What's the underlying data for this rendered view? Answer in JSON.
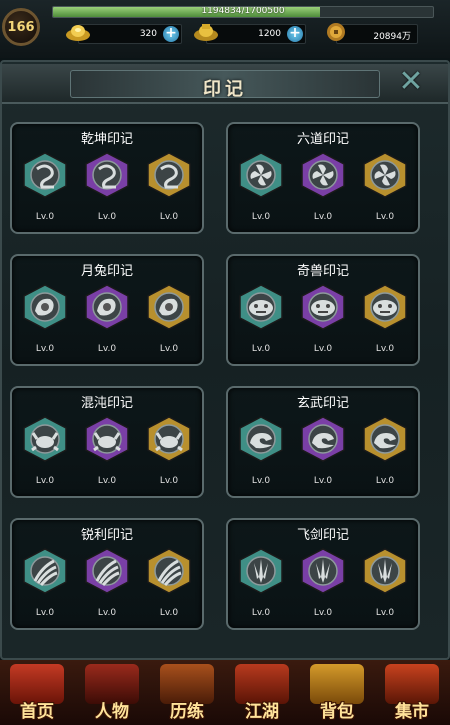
{
  "player": {
    "level": "166",
    "exp_text": "1194834/1700500",
    "exp_fraction": 0.702
  },
  "resources": [
    {
      "name": "gold-ingot",
      "value": "320"
    },
    {
      "name": "silver-ingot",
      "value": "1200"
    },
    {
      "name": "coin",
      "value": "20894万"
    }
  ],
  "panel": {
    "title": "印记"
  },
  "marks": [
    {
      "name": "乾坤印记",
      "emblem": "swirl-glyph",
      "levels": [
        "Lv.0",
        "Lv.0",
        "Lv.0"
      ]
    },
    {
      "name": "六道印记",
      "emblem": "pinwheel-glyph",
      "levels": [
        "Lv.0",
        "Lv.0",
        "Lv.0"
      ]
    },
    {
      "name": "月兔印记",
      "emblem": "rabbit-glyph",
      "levels": [
        "Lv.0",
        "Lv.0",
        "Lv.0"
      ]
    },
    {
      "name": "奇兽印记",
      "emblem": "beast-glyph",
      "levels": [
        "Lv.0",
        "Lv.0",
        "Lv.0"
      ]
    },
    {
      "name": "混沌印记",
      "emblem": "crab-glyph",
      "levels": [
        "Lv.0",
        "Lv.0",
        "Lv.0"
      ]
    },
    {
      "name": "玄武印记",
      "emblem": "turtle-glyph",
      "levels": [
        "Lv.0",
        "Lv.0",
        "Lv.0"
      ]
    },
    {
      "name": "锐利印记",
      "emblem": "claw-glyph",
      "levels": [
        "Lv.0",
        "Lv.0",
        "Lv.0"
      ]
    },
    {
      "name": "飞剑印记",
      "emblem": "sword-glyph",
      "levels": [
        "Lv.0",
        "Lv.0",
        "Lv.0"
      ]
    }
  ],
  "tiers": [
    {
      "name": "teal",
      "color": "#3f8f86"
    },
    {
      "name": "purple",
      "color": "#7a3fa6"
    },
    {
      "name": "gold",
      "color": "#b8902e"
    }
  ],
  "nav": [
    {
      "label": "首页",
      "icon": "home-icon"
    },
    {
      "label": "人物",
      "icon": "character-icon"
    },
    {
      "label": "历练",
      "icon": "training-icon"
    },
    {
      "label": "江湖",
      "icon": "jianghu-icon"
    },
    {
      "label": "背包",
      "icon": "bag-icon"
    },
    {
      "label": "集市",
      "icon": "market-icon"
    }
  ]
}
